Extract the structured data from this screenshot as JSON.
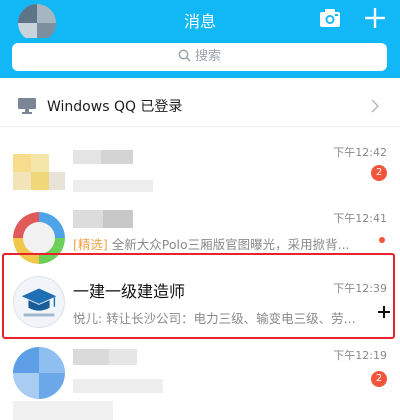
{
  "header": {
    "title": "消息",
    "camera_icon": "camera-icon",
    "add_icon": "plus-icon"
  },
  "search": {
    "placeholder": "搜索"
  },
  "windows_qq": {
    "label": "Windows QQ 已登录",
    "icon": "monitor-icon"
  },
  "conversations": [
    {
      "time": "下午12:42",
      "badge": "2"
    },
    {
      "time": "下午12:41",
      "preview_tag": "[精选]",
      "preview_text": " 全新大众Polo三厢版官图曝光，采用掀背..."
    },
    {
      "name": "一建一级建造师",
      "time": "下午12:39",
      "preview": "悦儿: 转让长沙公司：电力三级、输变电三级、劳..."
    },
    {
      "time": "下午12:19",
      "badge": "2"
    }
  ],
  "colors": {
    "header_bg": "#12b7f5",
    "badge_red": "#f2553b",
    "highlight_border": "#e8232a"
  }
}
